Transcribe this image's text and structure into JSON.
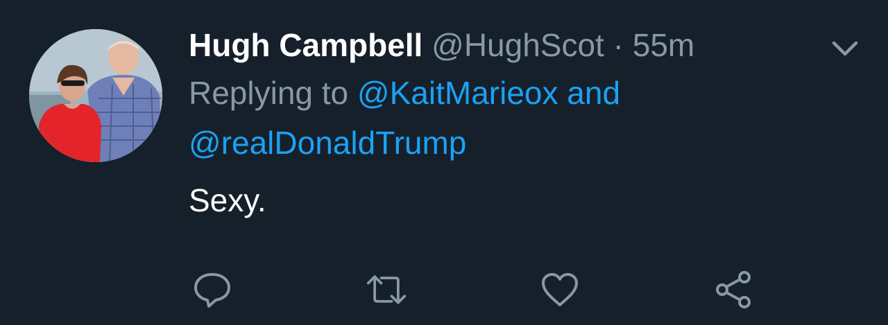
{
  "tweet": {
    "author_name": "Hugh Campbell",
    "author_handle": "@HughScot",
    "separator": "·",
    "timestamp": "55m",
    "replying_prefix": "Replying to",
    "mention_1": "@KaitMarieox",
    "conjunction": "and",
    "mention_2": "@realDonaldTrump",
    "text": "Sexy."
  },
  "icons": {
    "more": "chevron-down-icon",
    "reply": "reply-bubble-icon",
    "retweet": "retweet-icon",
    "like": "heart-icon",
    "share": "share-icon"
  },
  "colors": {
    "background": "#15202b",
    "primary_text": "#ffffff",
    "secondary_text": "#8899a6",
    "link": "#1da1f2"
  }
}
